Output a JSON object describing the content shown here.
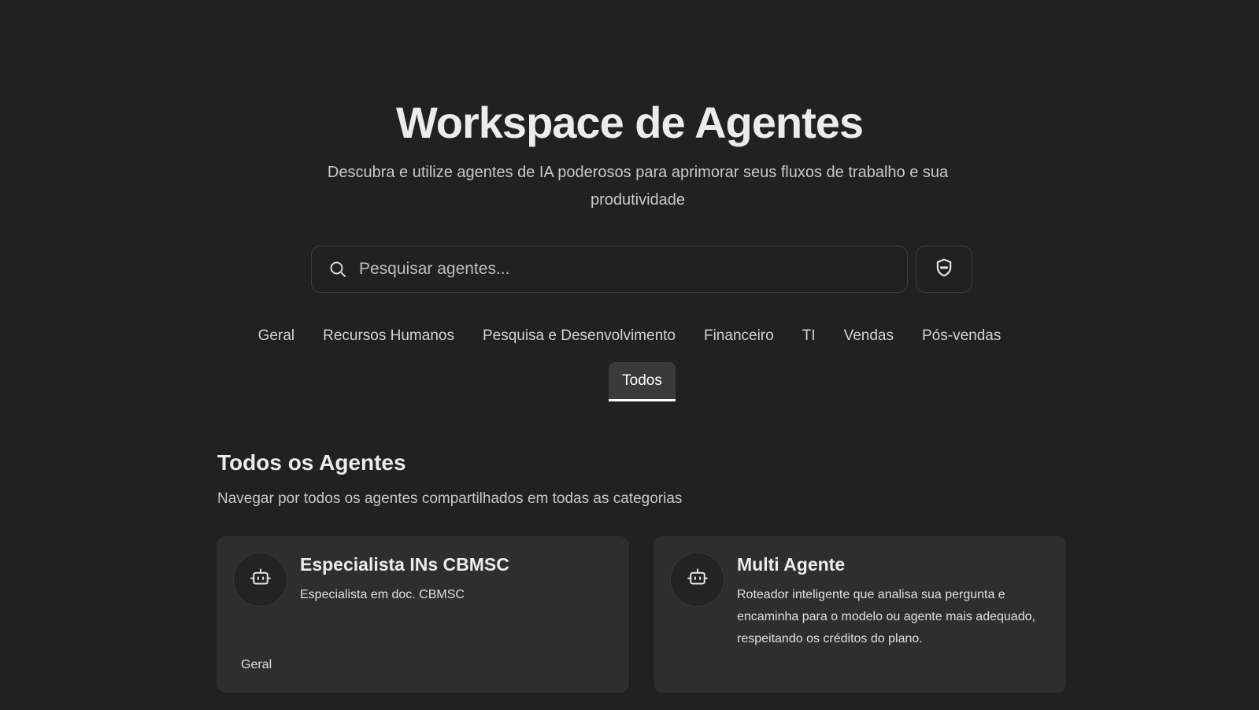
{
  "hero": {
    "title": "Workspace de Agentes",
    "subtitle": "Descubra e utilize agentes de IA poderosos para aprimorar seus fluxos de trabalho e sua produtividade"
  },
  "search": {
    "placeholder": "Pesquisar agentes...",
    "icon": "search-icon",
    "filter_icon": "shield-icon"
  },
  "categories": {
    "tabs": [
      "Geral",
      "Recursos Humanos",
      "Pesquisa e Desenvolvimento",
      "Financeiro",
      "TI",
      "Vendas",
      "Pós-vendas"
    ],
    "active": "Todos"
  },
  "section": {
    "title": "Todos os Agentes",
    "description": "Navegar por todos os agentes compartilhados em todas as categorias"
  },
  "agents": [
    {
      "name": "Especialista INs CBMSC",
      "description": "Especialista em doc. CBMSC",
      "category": "Geral",
      "icon": "robot-icon"
    },
    {
      "name": "Multi Agente",
      "description": "Roteador inteligente que analisa sua pergunta e encaminha para o modelo ou agente mais adequado, respeitando os créditos do plano.",
      "category": "",
      "icon": "robot-icon"
    }
  ],
  "colors": {
    "background": "#212121",
    "card": "#2e2e2e",
    "active_tab": "#3a3a3a",
    "text": "#ececec"
  }
}
